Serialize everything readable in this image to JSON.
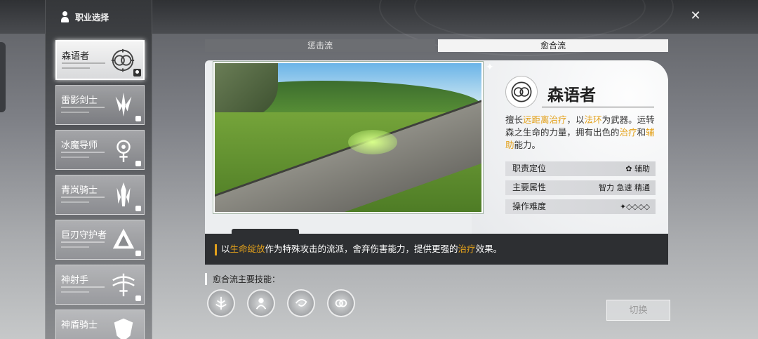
{
  "header": {
    "title": "职业选择",
    "close_icon": "close-icon"
  },
  "classes": [
    {
      "name": "森语者",
      "icon": "forest-emblem-icon",
      "active": true,
      "status": "selected"
    },
    {
      "name": "雷影剑士",
      "icon": "thunder-sword-emblem-icon",
      "active": false,
      "status": "locked"
    },
    {
      "name": "冰魔导师",
      "icon": "ice-mage-emblem-icon",
      "active": false,
      "status": "locked"
    },
    {
      "name": "青岚骑士",
      "icon": "wind-knight-emblem-icon",
      "active": false,
      "status": "locked"
    },
    {
      "name": "巨刃守护者",
      "icon": "blade-guardian-emblem-icon",
      "active": false,
      "status": "locked"
    },
    {
      "name": "神射手",
      "icon": "archer-emblem-icon",
      "active": false,
      "status": "locked"
    },
    {
      "name": "神盾骑士",
      "icon": "shield-knight-emblem-icon",
      "active": false,
      "status": "locked"
    }
  ],
  "tabs": [
    {
      "label": "惩击流",
      "active": false
    },
    {
      "label": "愈合流",
      "active": true
    }
  ],
  "detail": {
    "title": "森语者",
    "desc": {
      "p1": "擅长",
      "h1": "远距离治疗",
      "p2": "，以",
      "h2": "法环",
      "p3": "为武器。运转森之生命的力量，拥有出色的",
      "h3": "治疗",
      "p4": "和",
      "h4": "辅助",
      "p5": "能力。"
    },
    "attributes": [
      {
        "label": "职责定位",
        "value": "辅助"
      },
      {
        "label": "主要属性",
        "value": "智力 急速 精通"
      },
      {
        "label": "操作难度",
        "value": "✦◇◇◇◇"
      }
    ],
    "bottom": {
      "p1": "以",
      "h1": "生命绽放",
      "p2": "作为特殊攻击的流派，舍弃伤害能力，提供更强的",
      "h2": "治疗",
      "p3": "效果。"
    }
  },
  "skills": {
    "label": "愈合流主要技能：",
    "items": [
      "healing-tree-skill-icon",
      "spirit-summon-skill-icon",
      "vortex-skill-icon",
      "bloom-skill-icon"
    ]
  },
  "switch_button": "切换",
  "accent_color": "#e3a11b"
}
